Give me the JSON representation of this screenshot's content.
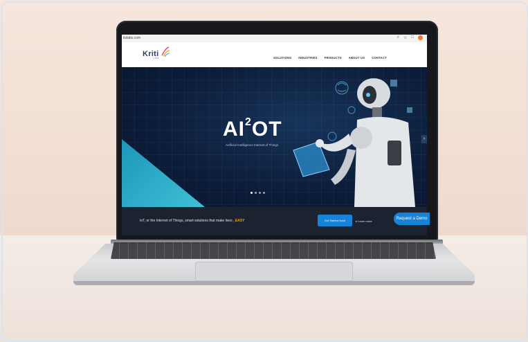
{
  "browser": {
    "url": "itslabs.com",
    "icons": [
      "search-icon",
      "star-icon",
      "extension-icon",
      "profile-icon"
    ]
  },
  "site": {
    "logo_text": "Kriti",
    "logo_sub": "Labs",
    "nav": [
      "SOLUTIONS",
      "INDUSTRIES",
      "PRODUCTS",
      "ABOUT US",
      "CONTACT"
    ]
  },
  "hero": {
    "title_pre": "AI",
    "title_sup": "2",
    "title_post": "OT",
    "subtitle": "Artificial Intelligence Internet of Things",
    "slides": 4,
    "active_slide": 1
  },
  "bottom_bar": {
    "text": "IoT, or the Internet of Things, smart solutions that make lives",
    "highlight": "EASY",
    "primary_button": "Get Started Now!",
    "secondary_link": "Learn more"
  },
  "floating_cta": "Request a Demo",
  "colors": {
    "accent": "#1682d8",
    "highlight": "#f4a300",
    "hero_bg": "#0c1c38",
    "triangle": "#2bb0cc"
  }
}
